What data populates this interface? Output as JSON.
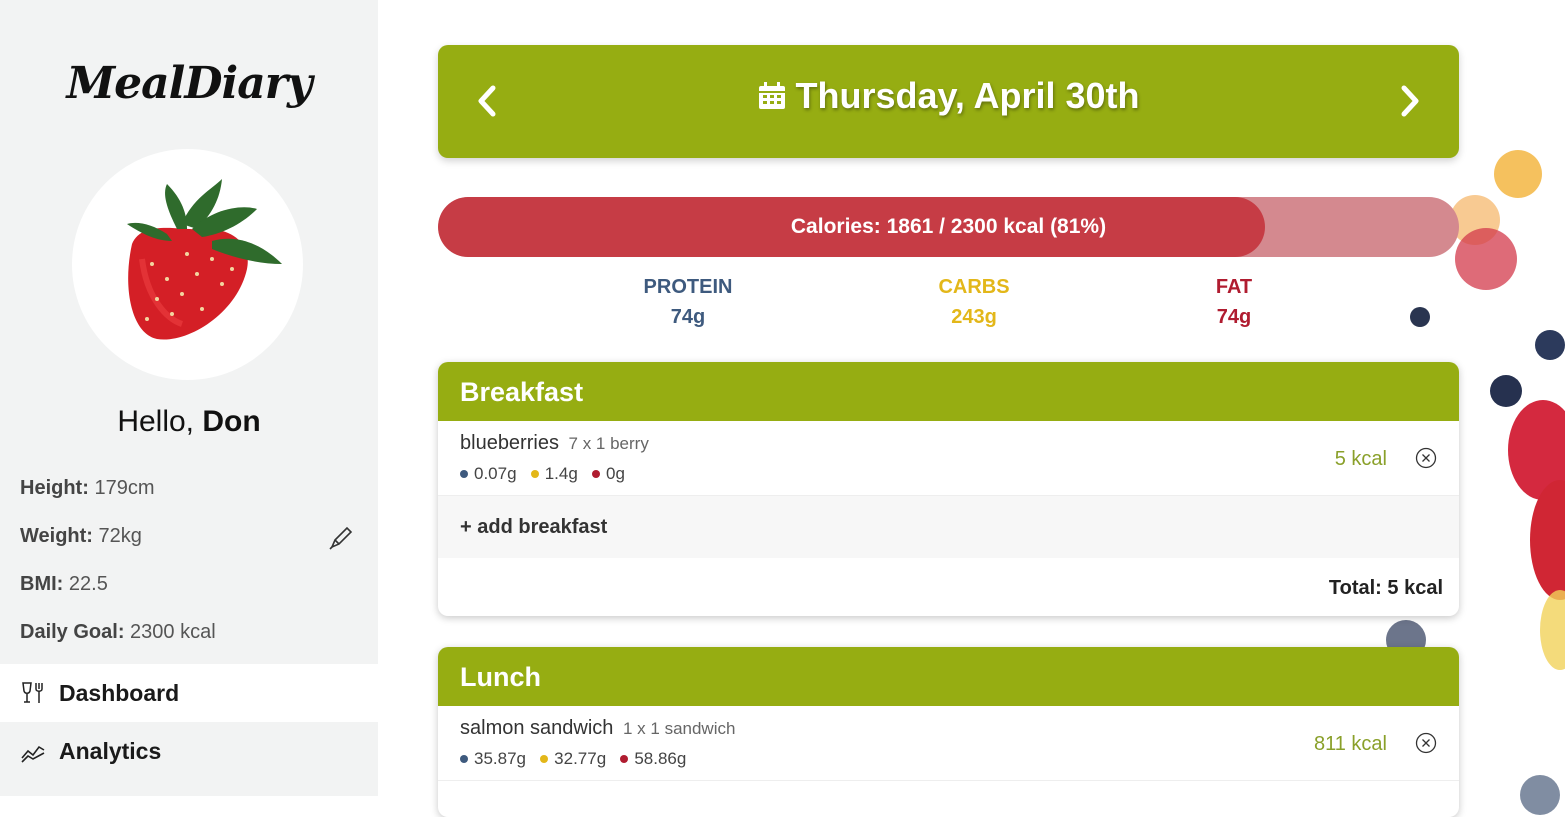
{
  "app": {
    "logo": "MealDiary"
  },
  "user": {
    "greeting": "Hello,",
    "name": "Don",
    "height_label": "Height:",
    "height": "179cm",
    "weight_label": "Weight:",
    "weight": "72kg",
    "bmi_label": "BMI:",
    "bmi": "22.5",
    "goal_label": "Daily Goal:",
    "goal": "2300 kcal"
  },
  "nav": {
    "dashboard": "Dashboard",
    "analytics": "Analytics"
  },
  "date": {
    "title": "Thursday, April 30th"
  },
  "calories": {
    "text": "Calories: 1861 / 2300 kcal (81%)",
    "fraction": 0.81
  },
  "macros": {
    "protein_label": "PROTEIN",
    "protein": "74g",
    "carbs_label": "CARBS",
    "carbs": "243g",
    "fat_label": "FAT",
    "fat": "74g"
  },
  "colors": {
    "accent": "#96ad12",
    "calorie_fill": "#c63c45",
    "calorie_track": "#d4898f",
    "protein": "#3e5a7e",
    "carbs": "#e3b719",
    "fat": "#b01c30",
    "kcal": "#8aa02a"
  },
  "breakfast": {
    "title": "Breakfast",
    "items": [
      {
        "name": "blueberries",
        "qty": "7 x 1 berry",
        "protein": "0.07g",
        "carbs": "1.4g",
        "fat": "0g",
        "kcal": "5 kcal"
      }
    ],
    "add_label": "+ add breakfast",
    "total_label": "Total:",
    "total": "5 kcal"
  },
  "lunch": {
    "title": "Lunch",
    "items": [
      {
        "name": "salmon sandwich",
        "qty": "1 x 1 sandwich",
        "protein": "35.87g",
        "carbs": "32.77g",
        "fat": "58.86g",
        "kcal": "811 kcal"
      }
    ]
  }
}
